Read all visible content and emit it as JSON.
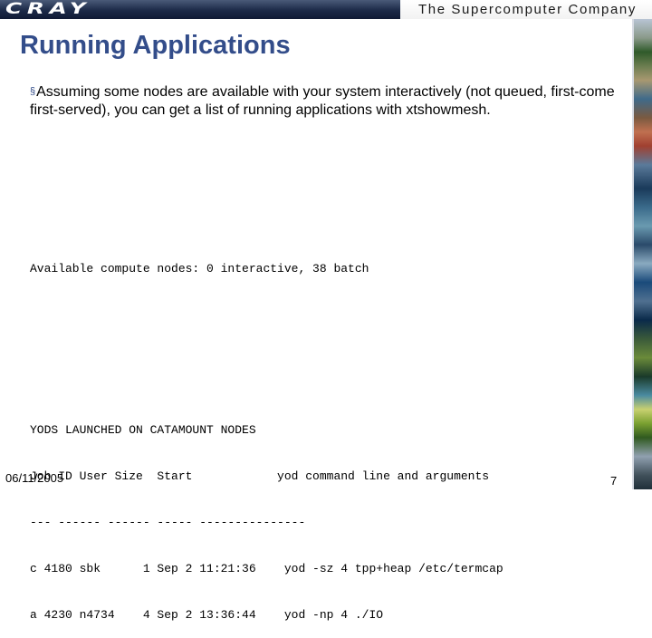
{
  "header": {
    "logo_text": "CRAY",
    "tagline": "The Supercomputer Company"
  },
  "slide": {
    "title": "Running Applications",
    "bullet_marker": "§",
    "bullet_text": "Assuming some nodes are available with your system interactively (not queued, first-come first-served), you can get a list of running applications with xtshowmesh."
  },
  "terminal": {
    "summary_line": "Available compute nodes: 0 interactive, 38 batch",
    "table_lines": [
      "YODS LAUNCHED ON CATAMOUNT NODES",
      "Job ID User Size  Start            yod command line and arguments",
      "--- ------ ------ ----- ---------------",
      "c 4180 sbk      1 Sep 2 11:21:36    yod -sz 4 tpp+heap /etc/termcap",
      "a 4230 n4734    4 Sep 2 13:36:44    yod -np 4 ./IO"
    ]
  },
  "footer": {
    "date": "06/11/2005",
    "page_number": "7"
  }
}
